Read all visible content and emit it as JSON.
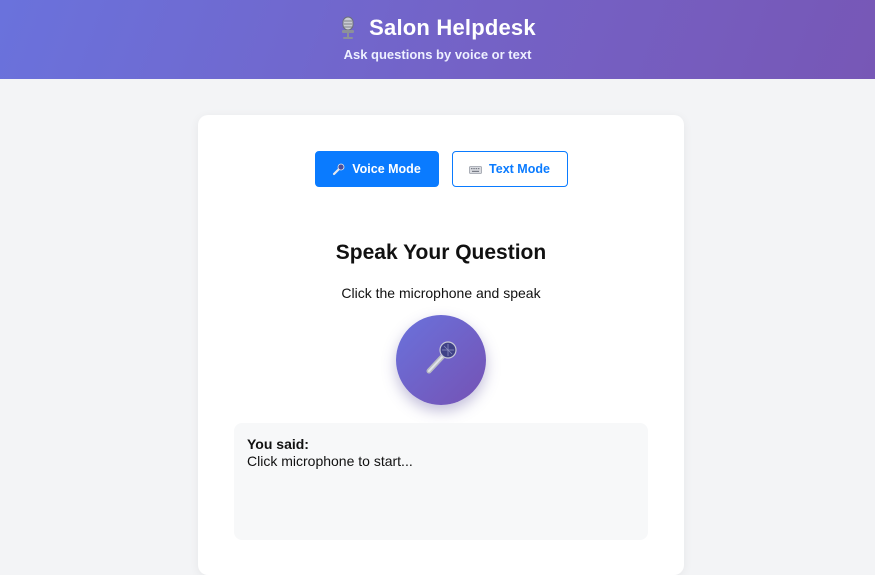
{
  "header": {
    "icon": "studio-microphone-icon",
    "title": "Salon Helpdesk",
    "subtitle": "Ask questions by voice or text"
  },
  "modes": {
    "voice": {
      "label": "Voice Mode",
      "icon": "microphone-icon",
      "active": true
    },
    "text": {
      "label": "Text Mode",
      "icon": "keyboard-icon",
      "active": false
    }
  },
  "voice_panel": {
    "title": "Speak Your Question",
    "instruction": "Click the microphone and speak",
    "mic_icon": "microphone-icon"
  },
  "transcript": {
    "label": "You said:",
    "text": "Click microphone to start..."
  },
  "colors": {
    "header_gradient_start": "#6a72dc",
    "header_gradient_end": "#7757b6",
    "accent": "#0a7bff",
    "page_background": "#f3f4f6",
    "transcript_background": "#f7f8f9"
  }
}
